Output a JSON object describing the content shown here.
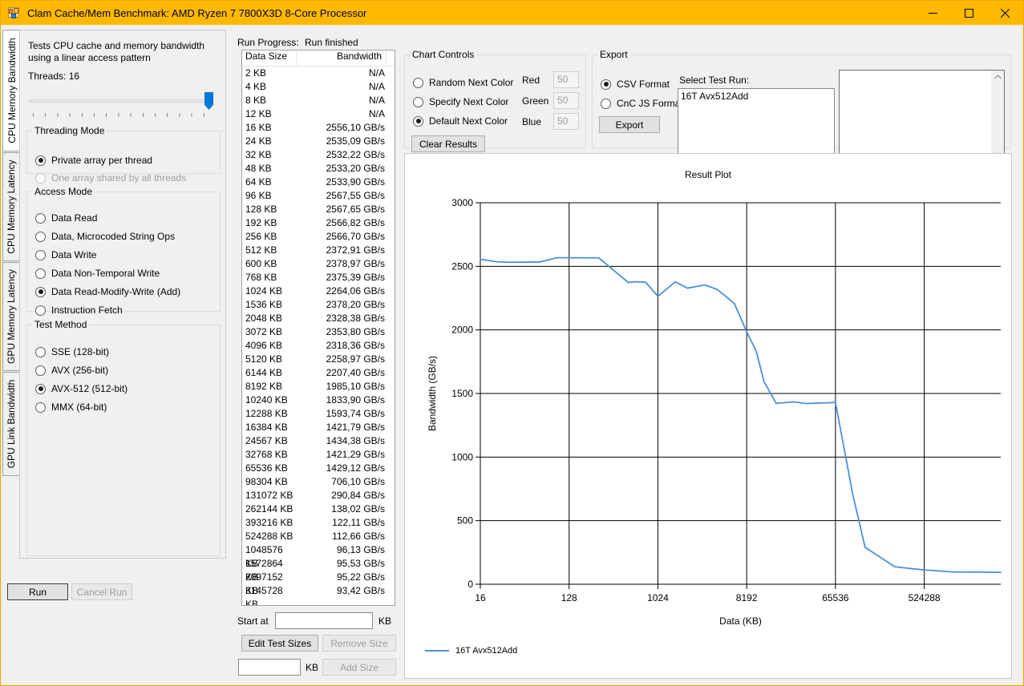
{
  "window": {
    "title": "Clam Cache/Mem Benchmark: AMD Ryzen 7 7800X3D 8-Core Processor",
    "icon": "app-icon",
    "minimize": "–",
    "maximize": "□",
    "close": "✕",
    "titlebar_color": "#ffb900"
  },
  "tabs": [
    {
      "label": "CPU Memory Bandwidth",
      "active": true
    },
    {
      "label": "CPU Memory Latency",
      "active": false
    },
    {
      "label": "GPU Memory Latency",
      "active": false
    },
    {
      "label": "GPU Link Bandwidth",
      "active": false
    }
  ],
  "left_panel": {
    "description": "Tests CPU cache and memory bandwidth using a linear access pattern",
    "threads_label": "Threads: 16",
    "threads_value": 16,
    "threading_mode": {
      "legend": "Threading Mode",
      "options": [
        {
          "label": "Private array per thread",
          "checked": true,
          "disabled": false
        },
        {
          "label": "One array shared by all threads",
          "checked": false,
          "disabled": true
        }
      ]
    },
    "access_mode": {
      "legend": "Access Mode",
      "options": [
        {
          "label": "Data Read",
          "checked": false
        },
        {
          "label": "Data, Microcoded String Ops",
          "checked": false
        },
        {
          "label": "Data Write",
          "checked": false
        },
        {
          "label": "Data Non-Temporal Write",
          "checked": false
        },
        {
          "label": "Data Read-Modify-Write (Add)",
          "checked": true
        },
        {
          "label": "Instruction Fetch",
          "checked": false
        }
      ]
    },
    "test_method": {
      "legend": "Test Method",
      "options": [
        {
          "label": "SSE (128-bit)",
          "checked": false
        },
        {
          "label": "AVX (256-bit)",
          "checked": false
        },
        {
          "label": "AVX-512 (512-bit)",
          "checked": true
        },
        {
          "label": "MMX (64-bit)",
          "checked": false
        }
      ]
    },
    "run_button": "Run",
    "cancel_button": "Cancel Run"
  },
  "results": {
    "run_progress_label": "Run Progress:",
    "run_progress_value": "Run finished",
    "columns": [
      "Data Size",
      "Bandwidth"
    ],
    "rows": [
      [
        "2 KB",
        "N/A"
      ],
      [
        "4 KB",
        "N/A"
      ],
      [
        "8 KB",
        "N/A"
      ],
      [
        "12 KB",
        "N/A"
      ],
      [
        "16 KB",
        "2556,10 GB/s"
      ],
      [
        "24 KB",
        "2535,09 GB/s"
      ],
      [
        "32 KB",
        "2532,22 GB/s"
      ],
      [
        "48 KB",
        "2533,20 GB/s"
      ],
      [
        "64 KB",
        "2533,90 GB/s"
      ],
      [
        "96 KB",
        "2567,55 GB/s"
      ],
      [
        "128 KB",
        "2567,65 GB/s"
      ],
      [
        "192 KB",
        "2566,82 GB/s"
      ],
      [
        "256 KB",
        "2566,70 GB/s"
      ],
      [
        "512 KB",
        "2372,91 GB/s"
      ],
      [
        "600 KB",
        "2378,97 GB/s"
      ],
      [
        "768 KB",
        "2375,39 GB/s"
      ],
      [
        "1024 KB",
        "2264,06 GB/s"
      ],
      [
        "1536 KB",
        "2378,20 GB/s"
      ],
      [
        "2048 KB",
        "2328,38 GB/s"
      ],
      [
        "3072 KB",
        "2353,80 GB/s"
      ],
      [
        "4096 KB",
        "2318,36 GB/s"
      ],
      [
        "5120 KB",
        "2258,97 GB/s"
      ],
      [
        "6144 KB",
        "2207,40 GB/s"
      ],
      [
        "8192 KB",
        "1985,10 GB/s"
      ],
      [
        "10240 KB",
        "1833,90 GB/s"
      ],
      [
        "12288 KB",
        "1593,74 GB/s"
      ],
      [
        "16384 KB",
        "1421,79 GB/s"
      ],
      [
        "24567 KB",
        "1434,38 GB/s"
      ],
      [
        "32768 KB",
        "1421,29 GB/s"
      ],
      [
        "65536 KB",
        "1429,12 GB/s"
      ],
      [
        "98304 KB",
        "706,10 GB/s"
      ],
      [
        "131072 KB",
        "290,84 GB/s"
      ],
      [
        "262144 KB",
        "138,02 GB/s"
      ],
      [
        "393216 KB",
        "122,11 GB/s"
      ],
      [
        "524288 KB",
        "112,66 GB/s"
      ],
      [
        "1048576 KB",
        "96,13 GB/s"
      ],
      [
        "1572864 KB",
        "95,53 GB/s"
      ],
      [
        "2097152 KB",
        "95,22 GB/s"
      ],
      [
        "3145728 KB",
        "93,42 GB/s"
      ]
    ],
    "start_at_label": "Start at",
    "start_at_value": "",
    "start_at_unit": "KB",
    "edit_test_sizes_button": "Edit Test Sizes",
    "remove_size_button": "Remove Size",
    "add_size_value": "",
    "add_size_unit": "KB",
    "add_size_button": "Add Size"
  },
  "chart_controls": {
    "legend": "Chart Controls",
    "options": [
      {
        "label": "Random Next Color",
        "checked": false
      },
      {
        "label": "Specify Next Color",
        "checked": false
      },
      {
        "label": "Default Next Color",
        "checked": true
      }
    ],
    "rgb": [
      {
        "label": "Red",
        "value": "50"
      },
      {
        "label": "Green",
        "value": "50"
      },
      {
        "label": "Blue",
        "value": "50"
      }
    ],
    "clear_results_button": "Clear Results"
  },
  "export": {
    "legend": "Export",
    "options": [
      {
        "label": "CSV Format",
        "checked": true
      },
      {
        "label": "CnC JS Format",
        "checked": false
      }
    ],
    "export_button": "Export",
    "select_test_run_label": "Select Test Run:",
    "test_runs": [
      "16T Avx512Add"
    ],
    "log_text": ""
  },
  "chart_data": {
    "type": "line",
    "title": "Result Plot",
    "xlabel": "Data (KB)",
    "ylabel": "Bandwidth (GB/s)",
    "xscale": "log",
    "xticks": [
      16,
      128,
      1024,
      8192,
      65536,
      524288
    ],
    "xticklabels": [
      "16",
      "128",
      "1024",
      "8192",
      "65536",
      "524288"
    ],
    "yticks": [
      0,
      500,
      1000,
      1500,
      2000,
      2500,
      3000
    ],
    "yticklabels": [
      "0",
      "500",
      "1000",
      "1500",
      "2000",
      "2500",
      "3000"
    ],
    "ylim": [
      0,
      3000
    ],
    "xlim": [
      16,
      3145728
    ],
    "grid": true,
    "legend_position": "below-left",
    "series": [
      {
        "name": "16T Avx512Add",
        "color": "#4a90d9",
        "x": [
          16,
          24,
          32,
          48,
          64,
          96,
          128,
          192,
          256,
          512,
          600,
          768,
          1024,
          1536,
          2048,
          3072,
          4096,
          5120,
          6144,
          8192,
          10240,
          12288,
          16384,
          24567,
          32768,
          65536,
          98304,
          131072,
          262144,
          393216,
          524288,
          1048576,
          1572864,
          2097152,
          3145728
        ],
        "values": [
          2556.1,
          2535.09,
          2532.22,
          2533.2,
          2533.9,
          2567.55,
          2567.65,
          2566.82,
          2566.7,
          2372.91,
          2378.97,
          2375.39,
          2264.06,
          2378.2,
          2328.38,
          2353.8,
          2318.36,
          2258.97,
          2207.4,
          1985.1,
          1833.9,
          1593.74,
          1421.79,
          1434.38,
          1421.29,
          1429.12,
          706.1,
          290.84,
          138.02,
          122.11,
          112.66,
          96.13,
          95.53,
          95.22,
          93.42
        ]
      }
    ]
  }
}
